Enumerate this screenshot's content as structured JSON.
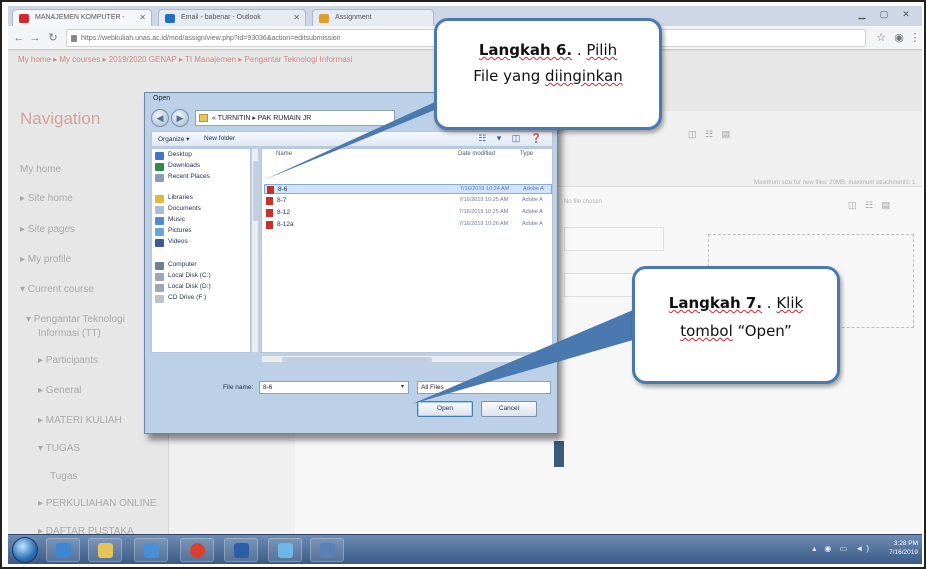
{
  "browser": {
    "tabs": [
      {
        "label": "MANAJEMEN KOMPUTER - ",
        "favicon_color": "#d9262c"
      },
      {
        "label": "Email - babenar - Outlook",
        "favicon_color": "#1f6fc4"
      },
      {
        "label": "Assignment",
        "favicon_color": "#e39b2a"
      }
    ],
    "url": "https://webkuliah.unas.ac.id/mod/assign/view.php?id=93036&action=editsubmission"
  },
  "page": {
    "breadcrumb": "My home ▸ My courses ▸ 2019/2020 GENAP ▸ TI Manajemen ▸ Pengantar Teknologi Informasi",
    "nav_title": "Navigation",
    "nav_items": [
      "My home",
      "▸ Site home",
      "▸ Site pages",
      "▸ My profile",
      "▾ Current course",
      "▾ Pengantar Teknologi",
      "Informasi (TT)",
      "▸ Participants",
      "▸ General",
      "▸ MATERI KULIAH",
      "▾ TUGAS",
      "Tugas",
      "▸ PERKULIAHAN ONLINE",
      "▸ DAFTAR PUSTAKA"
    ],
    "file_chosen_text": "No file chosen",
    "max_size_text": "Maximum size for new files: 20MB, maximum attachments: 1"
  },
  "dialog": {
    "title": "Open",
    "path": "« TURNITIN ▸ PAK RUMAIN JR",
    "cmd_organize": "Organize ▾",
    "cmd_new_folder": "New folder",
    "cmd_icons": "☷ ▾ ◫ ❓",
    "tree": [
      {
        "label": "Desktop",
        "color": "#3f77c8"
      },
      {
        "label": "Downloads",
        "color": "#2f8a4c"
      },
      {
        "label": "Recent Places",
        "color": "#8a9cb4"
      },
      {
        "label": "Libraries",
        "color": "#e2b83c"
      },
      {
        "label": "Documents",
        "color": "#a8bcd6"
      },
      {
        "label": "Music",
        "color": "#4e8bd0"
      },
      {
        "label": "Pictures",
        "color": "#6aa5d9"
      },
      {
        "label": "Videos",
        "color": "#3a5c8f"
      },
      {
        "label": "Computer",
        "color": "#6c7f96"
      },
      {
        "label": "Local Disk (C:)",
        "color": "#9aa7b6"
      },
      {
        "label": "Local Disk (D:)",
        "color": "#9aa7b6"
      },
      {
        "label": "CD Drive (F:)",
        "color": "#b8c4d2"
      }
    ],
    "columns": {
      "name": "Name",
      "date": "Date modified",
      "type": "Type"
    },
    "files": [
      {
        "name": "8-6",
        "date": "7/16/2019 10:24 AM",
        "type": "Adobe A"
      },
      {
        "name": "8-7",
        "date": "7/16/2019 10:25 AM",
        "type": "Adobe A"
      },
      {
        "name": "8-12",
        "date": "7/16/2019 10:25 AM",
        "type": "Adobe A"
      },
      {
        "name": "8-12a",
        "date": "7/16/2019 10:26 AM",
        "type": "Adobe A"
      }
    ],
    "file_name_label": "File name:",
    "file_name_value": "8-6",
    "file_type_value": "All Files",
    "open_label": "Open",
    "cancel_label": "Cancel"
  },
  "taskbar": {
    "apps": [
      {
        "name": "ie",
        "color": "#3d86d6"
      },
      {
        "name": "explorer",
        "color": "#e6c25a"
      },
      {
        "name": "chrome",
        "color": "#d9412f"
      },
      {
        "name": "word",
        "color": "#2b5faa"
      },
      {
        "name": "app5",
        "color": "#4a8fd4"
      },
      {
        "name": "app6",
        "color": "#6fb7e6"
      },
      {
        "name": "app7",
        "color": "#5a7fb6"
      }
    ],
    "time": "3:28 PM",
    "date": "7/16/2019"
  },
  "callouts": {
    "step6_bold": "Langkah 6.",
    "step6_dots": " . ",
    "step6_word1": "Pilih",
    "step6_line2a": "File yang ",
    "step6_line2b": "diinginkan",
    "step7_bold": "Langkah 7.",
    "step7_dots": " . ",
    "step7_word1": "Klik",
    "step7_line2a": "tombol",
    "step7_line2b": " “Open”"
  },
  "colors": {
    "callout_border": "#4a79b0",
    "callout_arrow": "#4a79b0"
  }
}
